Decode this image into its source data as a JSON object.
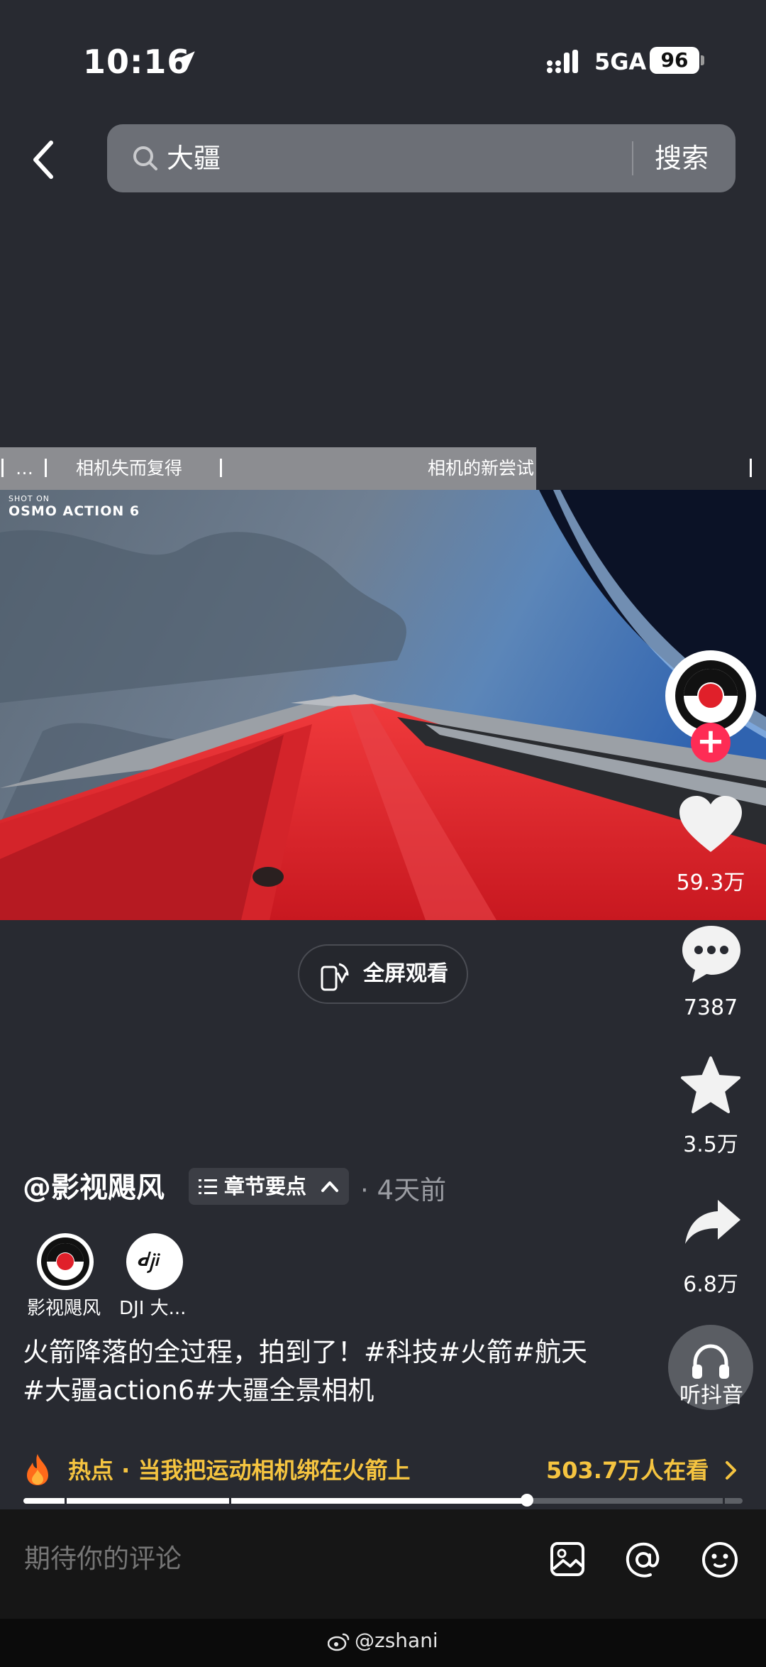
{
  "status_bar": {
    "time": "10:16",
    "network": "5GA",
    "battery": "96"
  },
  "search": {
    "value": "大疆",
    "button_label": "搜索"
  },
  "chapters": {
    "items": [
      "…",
      "相机失而复得",
      "相机的新尝试"
    ]
  },
  "video": {
    "watermark_small": "SHOT ON",
    "watermark_big": "OSMO ACTION 6"
  },
  "fullscreen_label": "全屏观看",
  "rail": {
    "likes": "59.3万",
    "comments": "7387",
    "favorites": "3.5万",
    "shares": "6.8万",
    "listen_label": "听抖音"
  },
  "post": {
    "author": "@影视飓风",
    "chapter_button": "章节要点",
    "time_ago": "· 4天前",
    "coauthors": [
      "影视飓风",
      "DJI 大..."
    ],
    "description": "火箭降落的全过程，拍到了！#科技#火箭#航天#大疆action6#大疆全景相机"
  },
  "hot": {
    "label": "热点 · 当我把运动相机绑在火箭上",
    "viewers": "503.7万人在看"
  },
  "progress": 0.7,
  "comment": {
    "placeholder": "期待你的评论"
  },
  "watermark": "@zshani",
  "colors": {
    "background": "#282a31",
    "accent_red": "#fe2c55",
    "hot_yellow": "#f5c440"
  }
}
